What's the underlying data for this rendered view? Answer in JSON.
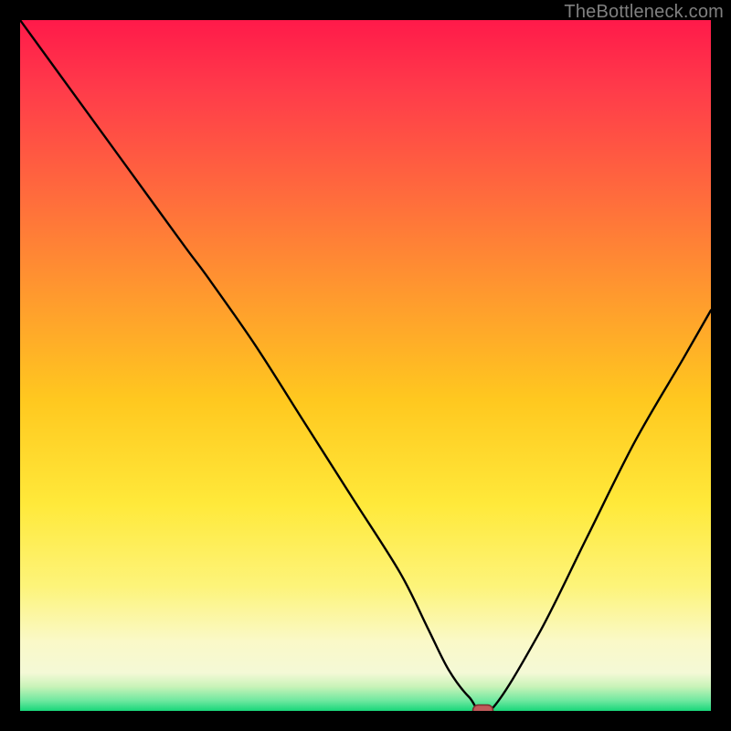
{
  "watermark": "TheBottleneck.com",
  "marker": {
    "color": "#c05a5a",
    "stroke": "#7a2f2f"
  },
  "chart_data": {
    "type": "line",
    "title": "",
    "xlabel": "",
    "ylabel": "",
    "xlim": [
      0,
      100
    ],
    "ylim": [
      0,
      100
    ],
    "series": [
      {
        "name": "curve",
        "x": [
          0,
          8,
          16,
          24,
          27,
          34,
          41,
          48,
          55,
          59,
          62,
          65,
          68,
          75,
          82,
          89,
          96,
          100
        ],
        "y": [
          100,
          89,
          78,
          67,
          63,
          53,
          42,
          31,
          20,
          12,
          6,
          2,
          0,
          11,
          25,
          39,
          51,
          58
        ]
      }
    ],
    "marker_point": {
      "x": 67,
      "y": 0
    },
    "gradient_stops": [
      {
        "offset": 0.0,
        "color": "#ff1a4a"
      },
      {
        "offset": 0.1,
        "color": "#ff3b4a"
      },
      {
        "offset": 0.25,
        "color": "#ff6a3d"
      },
      {
        "offset": 0.4,
        "color": "#ff9a2e"
      },
      {
        "offset": 0.55,
        "color": "#ffc81f"
      },
      {
        "offset": 0.7,
        "color": "#ffe93a"
      },
      {
        "offset": 0.82,
        "color": "#fdf47a"
      },
      {
        "offset": 0.9,
        "color": "#faf9c8"
      },
      {
        "offset": 0.945,
        "color": "#f4f9d6"
      },
      {
        "offset": 0.965,
        "color": "#c8f3b8"
      },
      {
        "offset": 0.985,
        "color": "#6fe8a0"
      },
      {
        "offset": 1.0,
        "color": "#18d77a"
      }
    ]
  }
}
